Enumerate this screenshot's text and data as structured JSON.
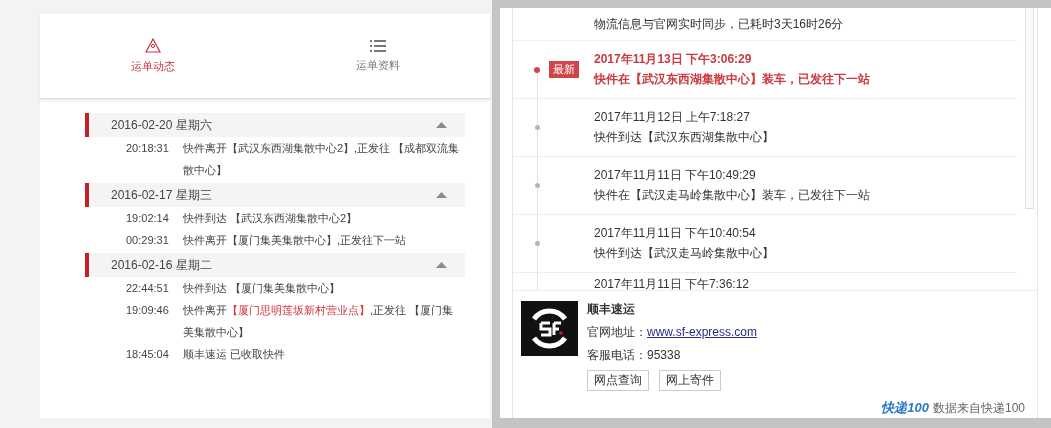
{
  "waybill": {
    "tabs": [
      {
        "label": "运单动态",
        "selected": true
      },
      {
        "label": "运单资料",
        "selected": false
      }
    ],
    "days": [
      {
        "date": "2016-02-20 星期六",
        "expanded": true,
        "events": [
          {
            "time": "20:18:31",
            "parts": [
              {
                "text": "快件离开【武汉东西湖集散中心2】,正发往 【成都双流集散中心】",
                "highlighted": false
              }
            ]
          }
        ]
      },
      {
        "date": "2016-02-17 星期三",
        "expanded": true,
        "events": [
          {
            "time": "19:02:14",
            "parts": [
              {
                "text": "快件到达 【武汉东西湖集散中心2】",
                "highlighted": false
              }
            ]
          },
          {
            "time": "00:29:31",
            "parts": [
              {
                "text": "快件离开【厦门集美集散中心】,正发往下一站",
                "highlighted": false
              }
            ]
          }
        ]
      },
      {
        "date": "2016-02-16 星期二",
        "expanded": true,
        "events": [
          {
            "time": "22:44:51",
            "parts": [
              {
                "text": "快件到达 【厦门集美集散中心】",
                "highlighted": false
              }
            ]
          },
          {
            "time": "19:09:46",
            "parts": [
              {
                "text": "快件离开",
                "highlighted": false
              },
              {
                "text": "【厦门思明莲坂新村营业点】",
                "highlighted": true
              },
              {
                "text": ",正发往 【厦门集美集散中心】",
                "highlighted": false
              }
            ]
          },
          {
            "time": "18:45:04",
            "parts": [
              {
                "text": "顺丰速运 已收取快件",
                "highlighted": false
              }
            ]
          }
        ]
      }
    ]
  },
  "tracking": {
    "sync_note": "物流信息与官网实时同步，已耗时3天16时26分",
    "entries": [
      {
        "latest": true,
        "badge": "最新",
        "datetime": "2017年11月13日 下午3:06:29",
        "text": "快件在【武汉东西湖集散中心】装车，已发往下一站"
      },
      {
        "latest": false,
        "datetime": "2017年11月12日 上午7:18:27",
        "text": "快件到达【武汉东西湖集散中心】"
      },
      {
        "latest": false,
        "datetime": "2017年11月11日 下午10:49:29",
        "text": "快件在【武汉走马岭集散中心】装车，已发往下一站"
      },
      {
        "latest": false,
        "datetime": "2017年11月11日 下午10:40:54",
        "text": "快件到达【武汉走马岭集散中心】"
      },
      {
        "latest": false,
        "datetime": "2017年11月11日 下午7:36:12"
      }
    ],
    "company": {
      "name": "顺丰速运",
      "website_label": "官网地址：",
      "website": "www.sf-express.com",
      "phone_label": "客服电话：",
      "phone": "95338",
      "buttons": [
        "网点查询",
        "网上寄件"
      ]
    },
    "credit": {
      "logo": "快递100",
      "text": "数据来自快递100"
    }
  }
}
